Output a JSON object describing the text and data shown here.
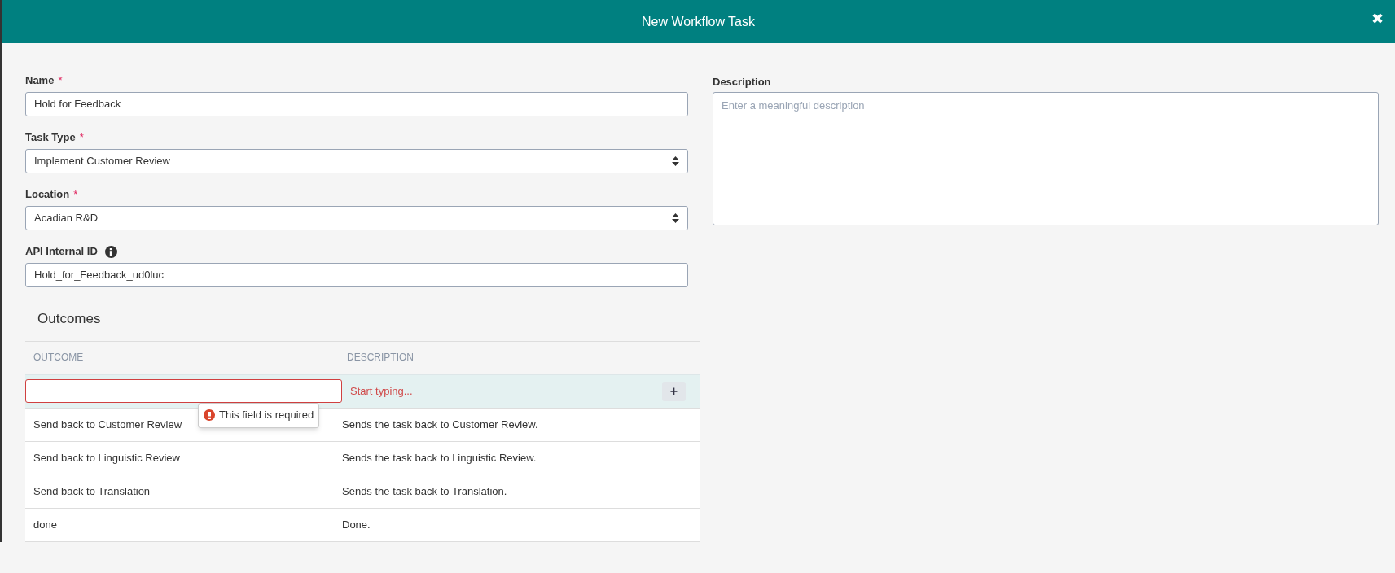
{
  "dialog": {
    "title": "New Workflow Task",
    "close": "✖"
  },
  "fields": [
    {
      "label": "Name",
      "required": "*",
      "kind": "input",
      "value": "Hold for Feedback"
    },
    {
      "label": "Task Type",
      "required": "*",
      "kind": "select",
      "value": "Implement Customer Review"
    },
    {
      "label": "Location",
      "required": "*",
      "kind": "select",
      "value": "Acadian R&D"
    },
    {
      "label": "API Internal ID",
      "info": true,
      "kind": "input",
      "value": "Hold_for_Feedback_ud0luc"
    }
  ],
  "description": {
    "label": "Description",
    "placeholder": "Enter a meaningful description"
  },
  "outcomes": {
    "title": "Outcomes",
    "columns": [
      "OUTCOME",
      "DESCRIPTION"
    ],
    "new_row": {
      "invalid": true,
      "description_placeholder": "Start typing...",
      "add": "+",
      "error": "This field is required"
    },
    "rows": [
      {
        "outcome": "Send back to Customer Review",
        "description": "Sends the task back to Customer Review."
      },
      {
        "outcome": "Send back to Linguistic Review",
        "description": "Sends the task back to Linguistic Review."
      },
      {
        "outcome": "Send back to Translation",
        "description": "Sends the task back to Translation."
      },
      {
        "outcome": "done",
        "description": "Done."
      }
    ]
  }
}
